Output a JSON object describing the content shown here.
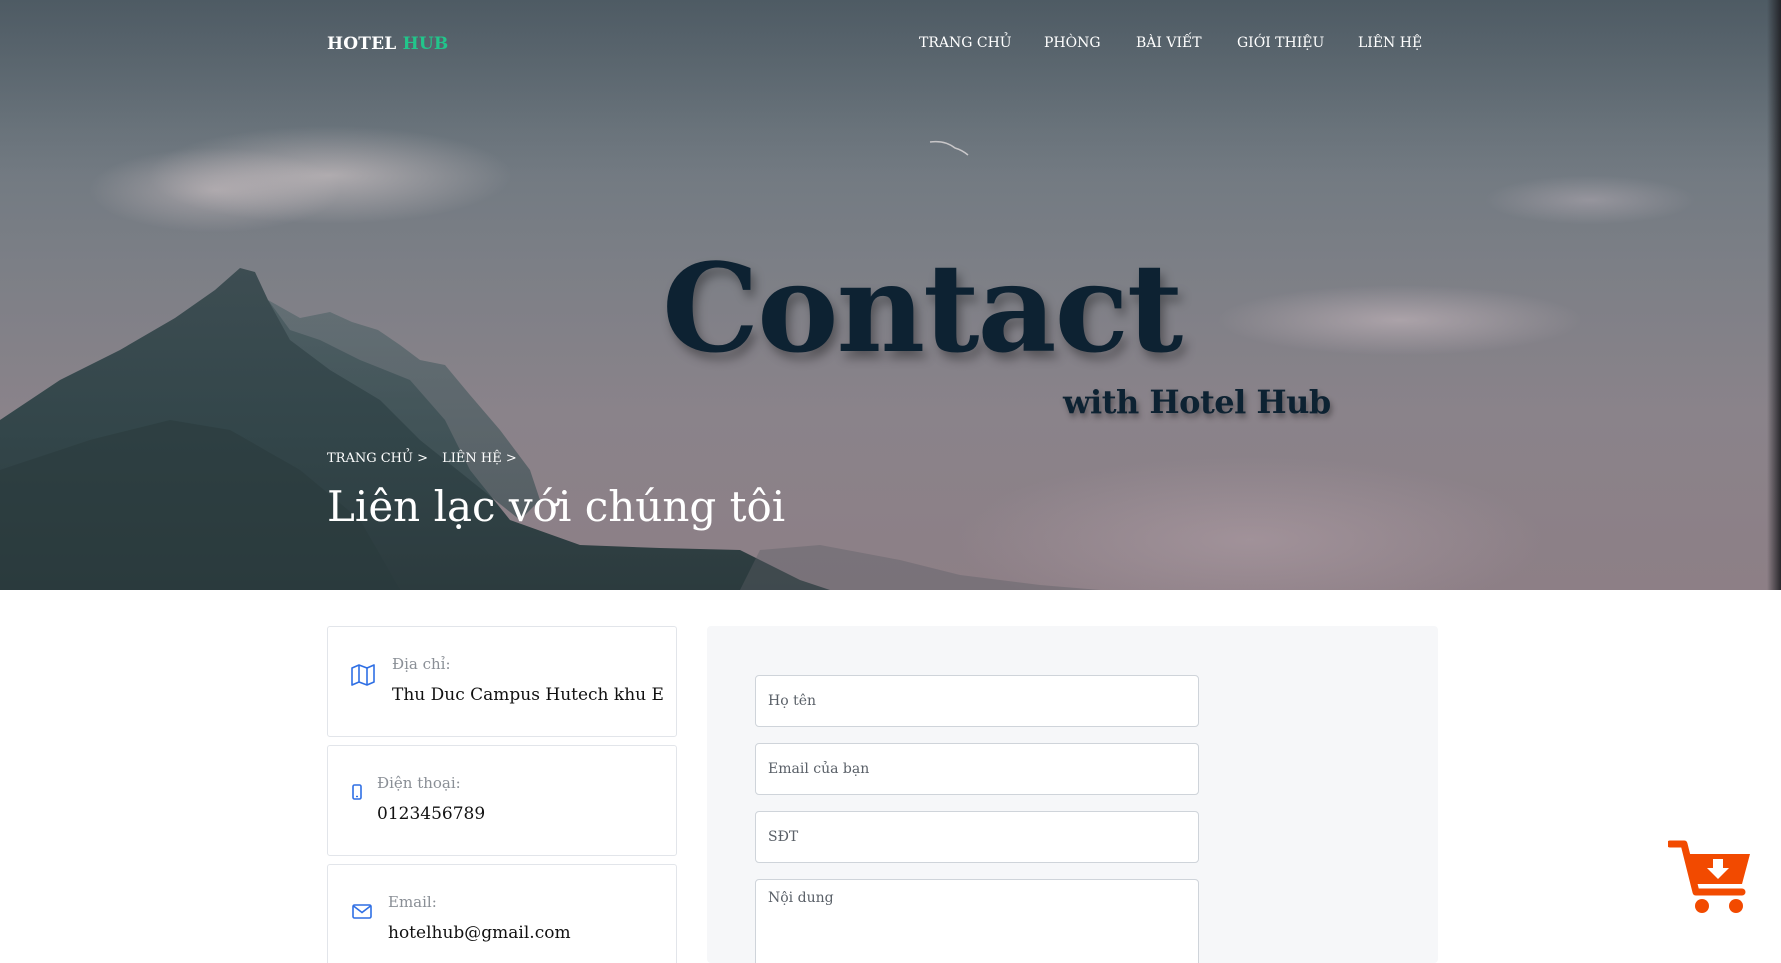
{
  "brand": {
    "part1": "HOTEL",
    "part2": "HUB"
  },
  "nav": {
    "items": [
      {
        "label": "TRANG CHỦ"
      },
      {
        "label": "PHÒNG"
      },
      {
        "label": "BÀI VIẾT"
      },
      {
        "label": "GIỚI THIỆU"
      },
      {
        "label": "LIÊN HỆ"
      }
    ]
  },
  "hero": {
    "title": "Contact",
    "subtitle": "with Hotel Hub",
    "breadcrumb": [
      "TRANG CHỦ >",
      "LIÊN HỆ >"
    ],
    "heading": "Liên lạc với chúng tôi"
  },
  "info": {
    "address": {
      "label": "Địa chỉ:",
      "value": "Thu Duc Campus Hutech khu E",
      "icon": "map-icon"
    },
    "phone": {
      "label": "Điện thoại:",
      "value": "0123456789",
      "icon": "phone-icon"
    },
    "email": {
      "label": "Email:",
      "value": "hotelhub@gmail.com",
      "icon": "envelope-icon"
    }
  },
  "form": {
    "name_placeholder": "Họ tên",
    "email_placeholder": "Email của bạn",
    "phone_placeholder": "SĐT",
    "message_placeholder": "Nội dung"
  },
  "colors": {
    "brand_accent": "#22c58b",
    "title_dark": "#0d2232",
    "icon_blue": "#2f6fe4",
    "cart_orange": "#f24a00"
  },
  "floating": {
    "icon": "cart-download-icon"
  }
}
